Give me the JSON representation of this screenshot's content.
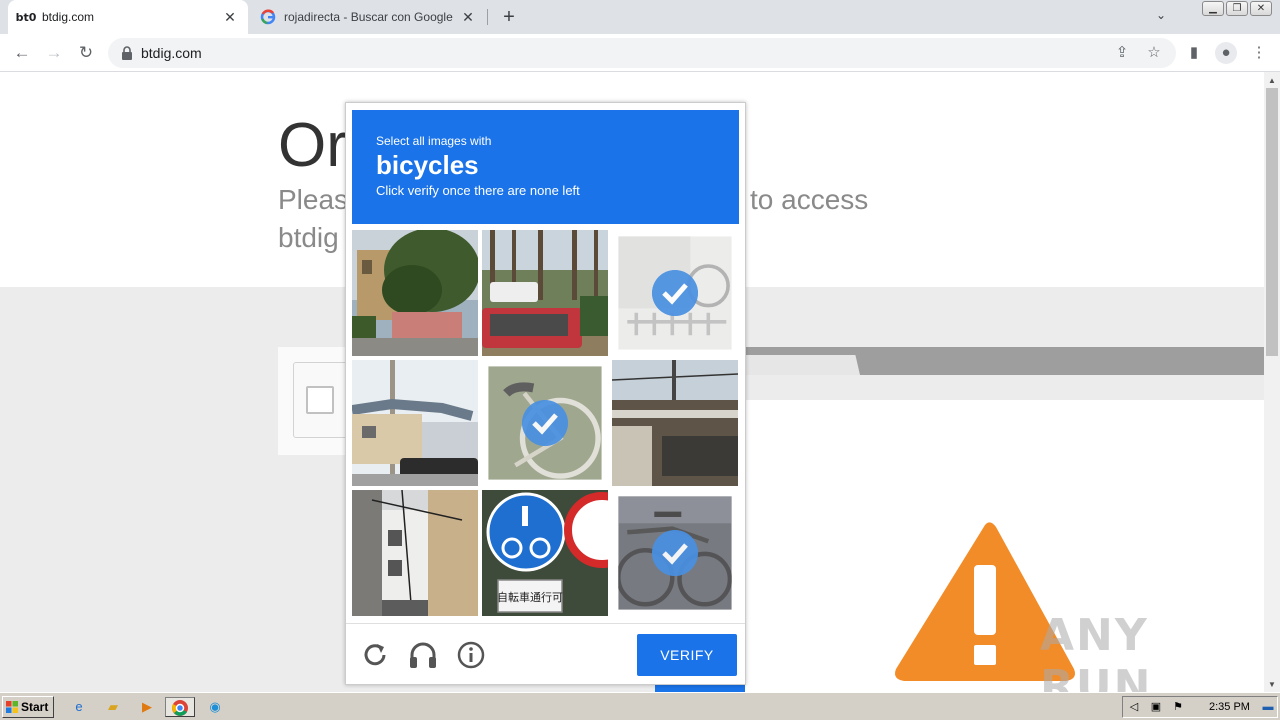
{
  "browser": {
    "tabs": [
      {
        "favicon": "bt0",
        "title": "btdig.com",
        "active": true
      },
      {
        "favicon": "G",
        "title": "rojadirecta - Buscar con Google",
        "active": false
      }
    ],
    "url": "btdig.com"
  },
  "page": {
    "title_partial": "Or",
    "subtitle_left": "Pleas",
    "subtitle_right": "to access",
    "subtitle_line2": "btdig"
  },
  "captcha": {
    "header": {
      "line1": "Select all images with",
      "keyword": "bicycles",
      "line3": "Click verify once there are none left"
    },
    "tiles": [
      {
        "subject": "house-with-trees",
        "selected": false
      },
      {
        "subject": "pickup-truck-trees",
        "selected": false
      },
      {
        "subject": "bicycle-rack-faded",
        "selected": true
      },
      {
        "subject": "houses-power-pole",
        "selected": false
      },
      {
        "subject": "bicycle-wheel",
        "selected": true
      },
      {
        "subject": "storefront-street",
        "selected": false
      },
      {
        "subject": "narrow-alley",
        "selected": false
      },
      {
        "subject": "bicycle-road-sign",
        "selected": false
      },
      {
        "subject": "parked-bicycles",
        "selected": true
      }
    ],
    "sign_text": "自転車通行可",
    "footer": {
      "reload_icon": "reload-icon",
      "audio_icon": "headphones-icon",
      "info_icon": "info-icon",
      "verify_label": "VERIFY"
    }
  },
  "watermark": "ANY RUN",
  "taskbar": {
    "start_label": "Start",
    "clock": "2:35 PM"
  },
  "colors": {
    "accent": "#1a73e8",
    "warning": "#f28c28"
  }
}
